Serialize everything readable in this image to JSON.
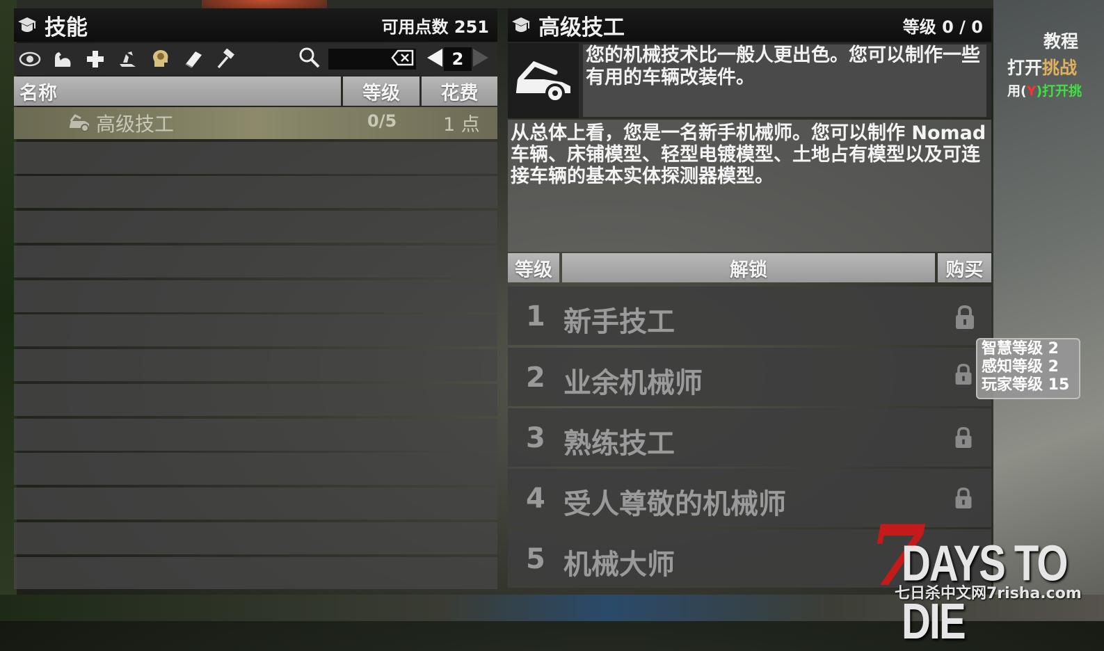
{
  "colors": {
    "accent_red": "#c41a1a",
    "header_bg": "#111111",
    "row_bg": "#464646",
    "selected_row": "#8c8a6b",
    "tooltip_bg": "#969696"
  },
  "left_panel": {
    "title": "技能",
    "points_label": "可用点数 251",
    "toolbar_icons": [
      "eye-icon",
      "strength-icon",
      "fortitude-icon",
      "agility-icon",
      "intellect-icon",
      "book-icon",
      "hammer-icon"
    ],
    "search_icon": "search-icon",
    "clear_icon": "backspace-icon",
    "page": "2",
    "columns": {
      "name": "名称",
      "level": "等级",
      "cost": "花费"
    },
    "skills": [
      {
        "name": "高级技工",
        "level": "0/5",
        "cost": "1 点",
        "icon": "car-icon",
        "selected": true
      }
    ],
    "empty_rows": 13
  },
  "right_panel": {
    "title": "高级技工",
    "level_label": "等级 0 / 0",
    "perk_icon": "car-hood-icon",
    "short_desc": "您的机械技术比一般人更出色。您可以制作一些有用的车辆改装件。",
    "long_desc": "从总体上看，您是一名新手机械师。您可以制作 Nomad 车辆、床铺模型、轻型电镀模型、土地占有模型以及可连接车辆的基本实体探测器模型。",
    "columns": {
      "level": "等级",
      "unlock": "解锁",
      "buy": "购买"
    },
    "ranks": [
      {
        "num": "1",
        "name": "新手技工"
      },
      {
        "num": "2",
        "name": "业余机械师"
      },
      {
        "num": "3",
        "name": "熟练技工"
      },
      {
        "num": "4",
        "name": "受人尊敬的机械师"
      },
      {
        "num": "5",
        "name": "机械大师"
      }
    ]
  },
  "tooltip": {
    "lines": [
      "智慧等级 2",
      "感知等级 2",
      "玩家等级 15"
    ]
  },
  "side_hints": {
    "line1": "教程",
    "line2_a": "打开",
    "line2_b": "挑战",
    "line3_a": "用(",
    "line3_key": "Y",
    "line3_b": ")打开挑"
  },
  "watermark": {
    "seven": "7",
    "days": "DAYS TO DIE",
    "site": "七日杀中文网7risha.com"
  }
}
